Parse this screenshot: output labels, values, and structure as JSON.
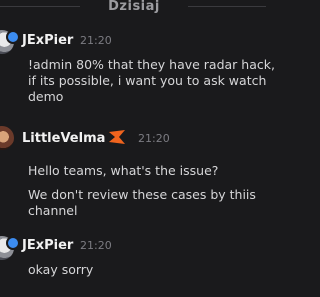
{
  "divider": {
    "label": "Dzisiaj"
  },
  "messages": [
    {
      "author": "JExPier",
      "time": "21:20",
      "lines": [
        "!admin 80% that they have radar hack,",
        "if its possible, i want you to ask watch",
        "demo"
      ]
    },
    {
      "author": "LittleVelma",
      "time": "21:20",
      "lines": [
        "Hello teams, what's the issue?",
        "We don't review these cases by thiis",
        "channel"
      ]
    },
    {
      "author": "JExPier",
      "time": "21:20",
      "lines": [
        "okay sorry"
      ]
    }
  ],
  "colors": {
    "background": "#1a1a1c",
    "username": "#f2f2f2",
    "timestamp": "#7c7c82",
    "message_text": "#d6d6d8",
    "badge_blue": "#3c8cf0",
    "staff_icon_orange": "#f0641e"
  },
  "icons": {
    "staff_badge": "orange-chevron-icon",
    "verified_badge": "blue-badge-icon"
  }
}
